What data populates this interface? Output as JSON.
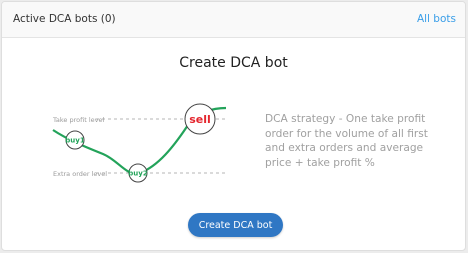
{
  "header": {
    "title": "Active DCA bots (0)",
    "link_label": "All bots"
  },
  "main": {
    "title": "Create DCA bot",
    "illustration": {
      "take_profit_label": "Take profit level",
      "extra_order_label": "Extra order level",
      "buy1_label": "buy1",
      "buy2_label": "buy2",
      "sell_label": "sell"
    },
    "description": "DCA strategy - One take profit order for the volume of all first and extra orders and average price + take profit %",
    "button_label": "Create DCA bot"
  },
  "colors": {
    "curve": "#23a35a",
    "sell": "#e4252d",
    "button": "#2f77c4",
    "link": "#3a9ee8"
  }
}
